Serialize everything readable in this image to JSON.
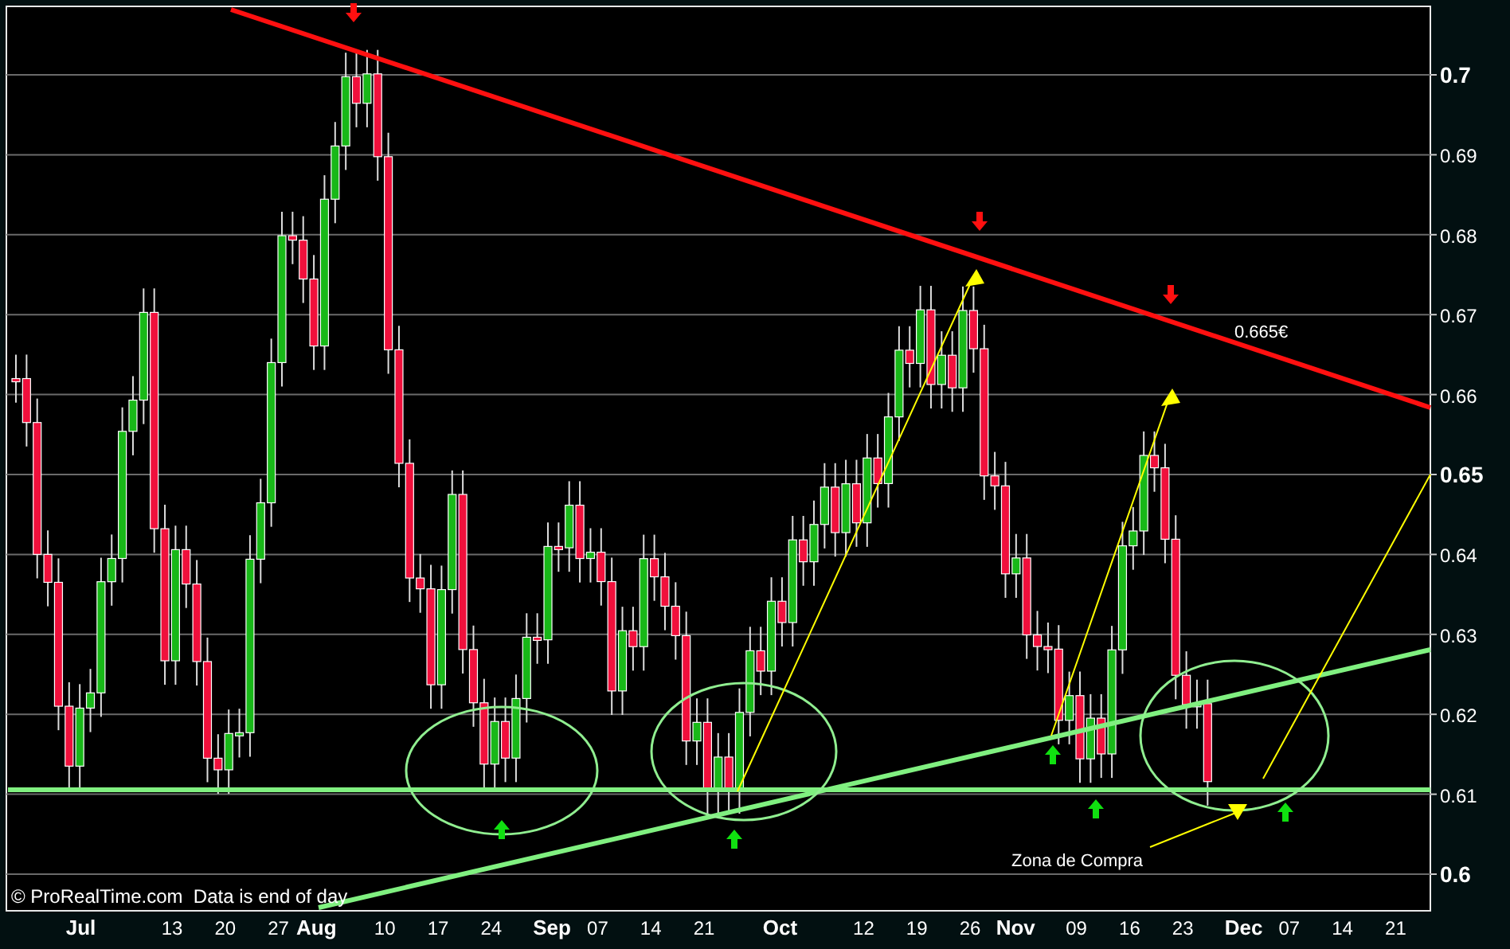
{
  "chart": {
    "price_label": "0.665€",
    "zone_label": "Zona de Compra",
    "footer": "© ProRealTime.com  Data is end of day"
  },
  "y_axis": [
    {
      "label": "0.7",
      "major": true
    },
    {
      "label": "0.69",
      "major": false
    },
    {
      "label": "0.68",
      "major": false
    },
    {
      "label": "0.67",
      "major": false
    },
    {
      "label": "0.66",
      "major": false
    },
    {
      "label": "0.65",
      "major": true
    },
    {
      "label": "0.64",
      "major": false
    },
    {
      "label": "0.63",
      "major": false
    },
    {
      "label": "0.62",
      "major": false
    },
    {
      "label": "0.61",
      "major": false
    },
    {
      "label": "0.6",
      "major": true
    }
  ],
  "x_axis": [
    {
      "label": "Jul",
      "kind": "month"
    },
    {
      "label": "13",
      "kind": "day"
    },
    {
      "label": "20",
      "kind": "day"
    },
    {
      "label": "27",
      "kind": "day"
    },
    {
      "label": "Aug",
      "kind": "month"
    },
    {
      "label": "10",
      "kind": "day"
    },
    {
      "label": "17",
      "kind": "day"
    },
    {
      "label": "24",
      "kind": "day"
    },
    {
      "label": "Sep",
      "kind": "month"
    },
    {
      "label": "07",
      "kind": "day"
    },
    {
      "label": "14",
      "kind": "day"
    },
    {
      "label": "21",
      "kind": "day"
    },
    {
      "label": "Oct",
      "kind": "month"
    },
    {
      "label": "12",
      "kind": "day"
    },
    {
      "label": "19",
      "kind": "day"
    },
    {
      "label": "26",
      "kind": "day"
    },
    {
      "label": "Nov",
      "kind": "month"
    },
    {
      "label": "09",
      "kind": "day"
    },
    {
      "label": "16",
      "kind": "day"
    },
    {
      "label": "23",
      "kind": "day"
    },
    {
      "label": "Dec",
      "kind": "month"
    },
    {
      "label": "07",
      "kind": "day"
    },
    {
      "label": "14",
      "kind": "day"
    },
    {
      "label": "21",
      "kind": "day"
    }
  ]
}
